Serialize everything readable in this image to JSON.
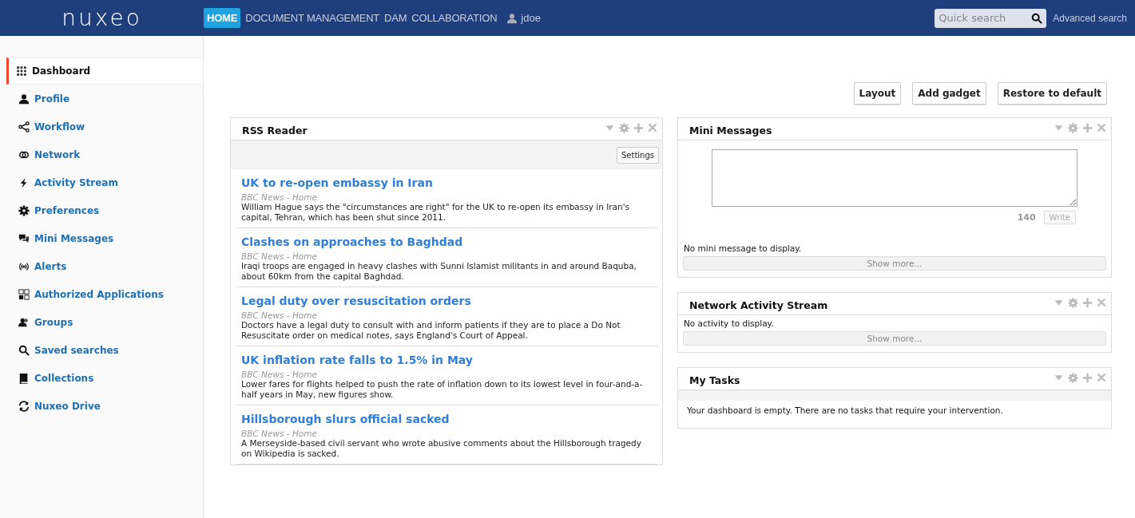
{
  "header": {
    "logo": "nuxeo",
    "nav": [
      {
        "label": "HOME",
        "selected": true
      },
      {
        "label": "DOCUMENT MANAGEMENT",
        "selected": false
      },
      {
        "label": "DAM",
        "selected": false
      },
      {
        "label": "COLLABORATION",
        "selected": false
      }
    ],
    "user": "jdoe",
    "search": {
      "placeholder": "Quick search"
    },
    "advanced_search": "Advanced search"
  },
  "sidebar": {
    "items": [
      {
        "label": "Dashboard",
        "selected": true
      },
      {
        "label": "Profile",
        "selected": false
      },
      {
        "label": "Workflow",
        "selected": false
      },
      {
        "label": "Network",
        "selected": false
      },
      {
        "label": "Activity Stream",
        "selected": false
      },
      {
        "label": "Preferences",
        "selected": false
      },
      {
        "label": "Mini Messages",
        "selected": false
      },
      {
        "label": "Alerts",
        "selected": false
      },
      {
        "label": "Authorized Applications",
        "selected": false
      },
      {
        "label": "Groups",
        "selected": false
      },
      {
        "label": "Saved searches",
        "selected": false
      },
      {
        "label": "Collections",
        "selected": false
      },
      {
        "label": "Nuxeo Drive",
        "selected": false
      }
    ]
  },
  "toolbar": [
    "Layout",
    "Add gadget",
    "Restore to default"
  ],
  "rss_reader": {
    "title": "RSS Reader",
    "settings_button": "Settings",
    "articles": [
      {
        "title": "UK to re-open embassy in Iran",
        "source": "BBC News - Home",
        "summary": "William Hague says the \"circumstances are right\" for the UK to re-open its embassy in Iran's capital, Tehran, which has been shut since 2011."
      },
      {
        "title": "Clashes on approaches to Baghdad",
        "source": "BBC News - Home",
        "summary": "Iraqi troops are engaged in heavy clashes with Sunni Islamist militants in and around Baquba, about 60km from the capital Baghdad."
      },
      {
        "title": "Legal duty over resuscitation orders",
        "source": "BBC News - Home",
        "summary": "Doctors have a legal duty to consult with and inform patients if they are to place a Do Not Resuscitate order on medical notes, says England's Court of Appeal."
      },
      {
        "title": "UK inflation rate falls to 1.5% in May",
        "source": "BBC News - Home",
        "summary": "Lower fares for flights helped to push the rate of inflation down to its lowest level in four-and-a-half years in May, new figures show."
      },
      {
        "title": "Hillsborough slurs official sacked",
        "source": "BBC News - Home",
        "summary": "A Merseyside-based civil servant who wrote abusive comments about the Hillsborough tragedy on Wikipedia is sacked."
      }
    ]
  },
  "mini_messages": {
    "title": "Mini Messages",
    "counter": "140",
    "write_button": {
      "label": "Write",
      "disabled": true
    },
    "empty_text": "No mini message to display.",
    "show_more": "Show more..."
  },
  "network_activity": {
    "title": "Network Activity Stream",
    "empty_text": "No activity to display.",
    "show_more": "Show more..."
  },
  "my_tasks": {
    "title": "My Tasks",
    "empty_text": "Your dashboard is empty. There are no tasks that require your intervention."
  }
}
